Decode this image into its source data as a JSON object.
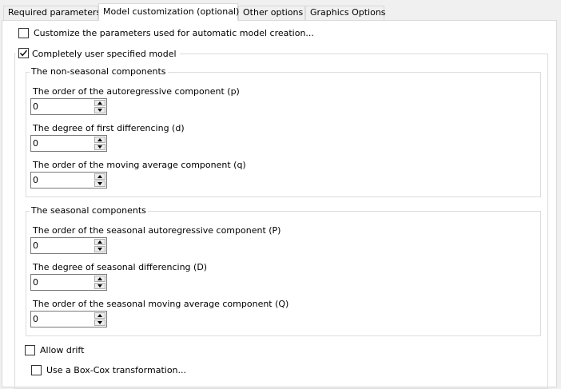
{
  "tabs": [
    {
      "label": "Required parameters",
      "active": false
    },
    {
      "label": "Model customization (optional)",
      "active": true
    },
    {
      "label": "Other options",
      "active": false
    },
    {
      "label": "Graphics Options",
      "active": false
    }
  ],
  "customize_auto": {
    "label": "Customize the parameters used for automatic model creation...",
    "checked": false
  },
  "user_specified": {
    "label": "Completely user specified model",
    "checked": true
  },
  "non_seasonal": {
    "title": "The non-seasonal components",
    "fields": [
      {
        "label": "The order of the autoregressive component (p)",
        "value": "0"
      },
      {
        "label": "The degree of first differencing (d)",
        "value": "0"
      },
      {
        "label": "The order of the moving average component (q)",
        "value": "0"
      }
    ]
  },
  "seasonal": {
    "title": "The seasonal components",
    "fields": [
      {
        "label": "The order of the seasonal autoregressive component (P)",
        "value": "0"
      },
      {
        "label": "The degree of seasonal differencing (D)",
        "value": "0"
      },
      {
        "label": "The order of the seasonal moving average component (Q)",
        "value": "0"
      }
    ]
  },
  "allow_drift": {
    "label": "Allow drift",
    "checked": false
  },
  "box_cox": {
    "label": "Use a Box-Cox transformation...",
    "checked": false
  }
}
